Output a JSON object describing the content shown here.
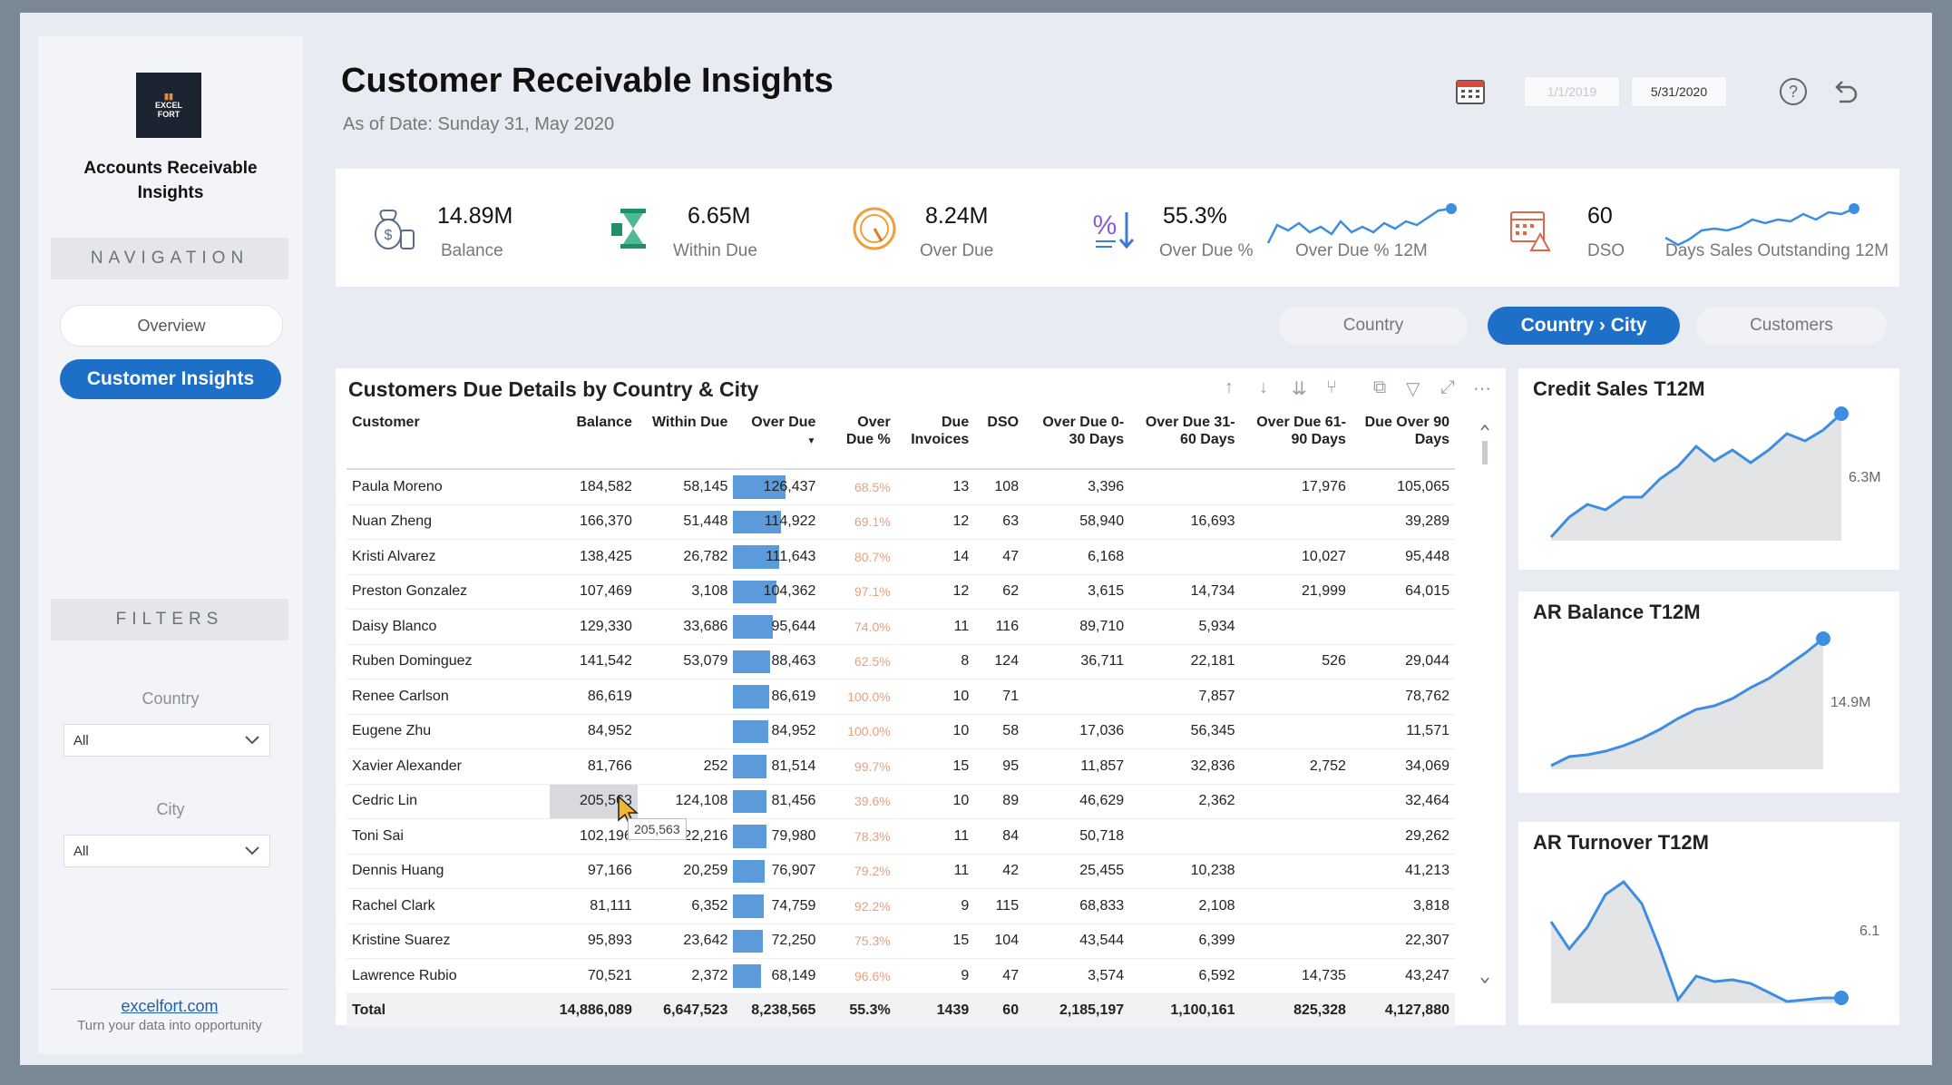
{
  "sidebar": {
    "logo_text": "EXCEL FORT",
    "app_name": "Accounts Receivable\nInsights",
    "nav_heading": "NAVIGATION",
    "nav_items": [
      {
        "label": "Overview",
        "active": false
      },
      {
        "label": "Customer Insights",
        "active": true
      }
    ],
    "filters_heading": "FILTERS",
    "filters": [
      {
        "label": "Country",
        "value": "All"
      },
      {
        "label": "City",
        "value": "All"
      }
    ],
    "footer_link": "excelfort.com",
    "footer_tagline": "Turn your data into opportunity"
  },
  "header": {
    "title": "Customer Receivable Insights",
    "subtitle": "As of Date: Sunday 31, May 2020",
    "date_from": "1/1/2019",
    "date_to": "5/31/2020",
    "icons": [
      "calendar-icon",
      "help-icon",
      "reset-icon"
    ]
  },
  "kpis": [
    {
      "value": "14.89M",
      "label": "Balance",
      "icon": "money-bag-icon"
    },
    {
      "value": "6.65M",
      "label": "Within Due",
      "icon": "hourglass-icon"
    },
    {
      "value": "8.24M",
      "label": "Over Due",
      "icon": "gauge-icon"
    },
    {
      "value": "55.3%",
      "label": "Over Due %",
      "icon": "percent-down-icon",
      "spark_label": "Over Due % 12M"
    },
    {
      "value": "60",
      "label": "DSO",
      "icon": "calendar-grid-icon",
      "spark_label": "Days Sales Outstanding 12M"
    }
  ],
  "view_tabs": [
    {
      "label": "Country",
      "active": false
    },
    {
      "label": "Country › City",
      "active": true
    },
    {
      "label": "Customers",
      "active": false
    }
  ],
  "table": {
    "title": "Customers Due Details by Country & City",
    "columns": [
      "Customer",
      "Balance",
      "Within Due",
      "Over Due",
      "Over Due %",
      "Due Invoices",
      "DSO",
      "Over Due 0-30 Days",
      "Over Due 31-60 Days",
      "Over Due 61-90 Days",
      "Due Over 90 Days"
    ],
    "rows": [
      [
        "Paula Moreno",
        "184,582",
        "58,145",
        "126,437",
        "68.5%",
        "13",
        "108",
        "3,396",
        "",
        "17,976",
        "105,065"
      ],
      [
        "Nuan Zheng",
        "166,370",
        "51,448",
        "114,922",
        "69.1%",
        "12",
        "63",
        "58,940",
        "16,693",
        "",
        "39,289"
      ],
      [
        "Kristi Alvarez",
        "138,425",
        "26,782",
        "111,643",
        "80.7%",
        "14",
        "47",
        "6,168",
        "",
        "10,027",
        "95,448"
      ],
      [
        "Preston Gonzalez",
        "107,469",
        "3,108",
        "104,362",
        "97.1%",
        "12",
        "62",
        "3,615",
        "14,734",
        "21,999",
        "64,015"
      ],
      [
        "Daisy Blanco",
        "129,330",
        "33,686",
        "95,644",
        "74.0%",
        "11",
        "116",
        "89,710",
        "5,934",
        "",
        ""
      ],
      [
        "Ruben Dominguez",
        "141,542",
        "53,079",
        "88,463",
        "62.5%",
        "8",
        "124",
        "36,711",
        "22,181",
        "526",
        "29,044"
      ],
      [
        "Renee Carlson",
        "86,619",
        "",
        "86,619",
        "100.0%",
        "10",
        "71",
        "",
        "7,857",
        "",
        "78,762"
      ],
      [
        "Eugene Zhu",
        "84,952",
        "",
        "84,952",
        "100.0%",
        "10",
        "58",
        "17,036",
        "56,345",
        "",
        "11,571"
      ],
      [
        "Xavier Alexander",
        "81,766",
        "252",
        "81,514",
        "99.7%",
        "15",
        "95",
        "11,857",
        "32,836",
        "2,752",
        "34,069"
      ],
      [
        "Cedric Lin",
        "205,563",
        "124,108",
        "81,456",
        "39.6%",
        "10",
        "89",
        "46,629",
        "2,362",
        "",
        "32,464"
      ],
      [
        "Toni Sai",
        "102,196",
        "22,216",
        "79,980",
        "78.3%",
        "11",
        "84",
        "50,718",
        "",
        "",
        "29,262"
      ],
      [
        "Dennis Huang",
        "97,166",
        "20,259",
        "76,907",
        "79.2%",
        "11",
        "42",
        "25,455",
        "10,238",
        "",
        "41,213"
      ],
      [
        "Rachel Clark",
        "81,111",
        "6,352",
        "74,759",
        "92.2%",
        "9",
        "115",
        "68,833",
        "2,108",
        "",
        "3,818"
      ],
      [
        "Kristine Suarez",
        "95,893",
        "23,642",
        "72,250",
        "75.3%",
        "15",
        "104",
        "43,544",
        "6,399",
        "",
        "22,307"
      ],
      [
        "Lawrence Rubio",
        "70,521",
        "2,372",
        "68,149",
        "96.6%",
        "9",
        "47",
        "3,574",
        "6,592",
        "14,735",
        "43,247"
      ]
    ],
    "total": [
      "Total",
      "14,886,089",
      "6,647,523",
      "8,238,565",
      "55.3%",
      "1439",
      "60",
      "2,185,197",
      "1,100,161",
      "825,328",
      "4,127,880"
    ],
    "tooltip": "205,563"
  },
  "charts": [
    {
      "title": "Credit Sales T12M",
      "end_label": "6.3M"
    },
    {
      "title": "AR Balance T12M",
      "end_label": "14.9M"
    },
    {
      "title": "AR Turnover T12M",
      "end_label": "6.1"
    }
  ],
  "colors": {
    "accent": "#1e6fc7",
    "bar": "#5b9bdc",
    "pct_text": "#e8a07d"
  }
}
